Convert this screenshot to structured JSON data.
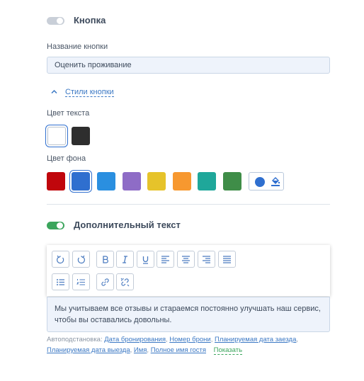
{
  "button_section": {
    "toggle_on": false,
    "title": "Кнопка",
    "name_label": "Название кнопки",
    "name_value": "Оценить проживание",
    "styles_link": "Стили кнопки"
  },
  "text_color": {
    "label": "Цвет текста",
    "swatches": [
      {
        "name": "white",
        "color": "#ffffff",
        "selected": true
      },
      {
        "name": "dark",
        "color": "#2e2e2e",
        "selected": false
      }
    ]
  },
  "bg_color": {
    "label": "Цвет фона",
    "swatches": [
      {
        "name": "red",
        "color": "#c0060c",
        "selected": false
      },
      {
        "name": "blue",
        "color": "#2f6fcf",
        "selected": true
      },
      {
        "name": "light-blue",
        "color": "#2a8fe0",
        "selected": false
      },
      {
        "name": "purple",
        "color": "#8e6cc6",
        "selected": false
      },
      {
        "name": "yellow",
        "color": "#e6c32a",
        "selected": false
      },
      {
        "name": "orange",
        "color": "#f7982f",
        "selected": false
      },
      {
        "name": "teal",
        "color": "#1fa79a",
        "selected": false
      },
      {
        "name": "green",
        "color": "#3f8d48",
        "selected": false
      }
    ],
    "custom_color": "#2f6fcf"
  },
  "extra_text": {
    "toggle_on": true,
    "title": "Дополнительный текст",
    "toolbar_icons": [
      "undo-icon",
      "redo-icon",
      "bold-icon",
      "italic-icon",
      "underline-icon",
      "align-left-icon",
      "align-center-icon",
      "align-right-icon",
      "align-justify-icon",
      "bullet-list-icon",
      "numbered-list-icon",
      "link-icon",
      "unlink-icon"
    ],
    "body": "Мы учитываем все отзывы и стараемся постоянно улучшать наш сервис, чтобы вы оставались довольны."
  },
  "autosub": {
    "label": "Автоподстановка:",
    "vars": [
      "Дата бронирования",
      "Номер брони",
      "Планируемая дата заезда",
      "Планируемая дата выезда",
      "Имя",
      "Полное имя гостя"
    ],
    "show": "Показать"
  },
  "colors": {
    "accent": "#3b78c4",
    "toggle_on": "#3ba55c",
    "toggle_off": "#c9cfd8"
  }
}
